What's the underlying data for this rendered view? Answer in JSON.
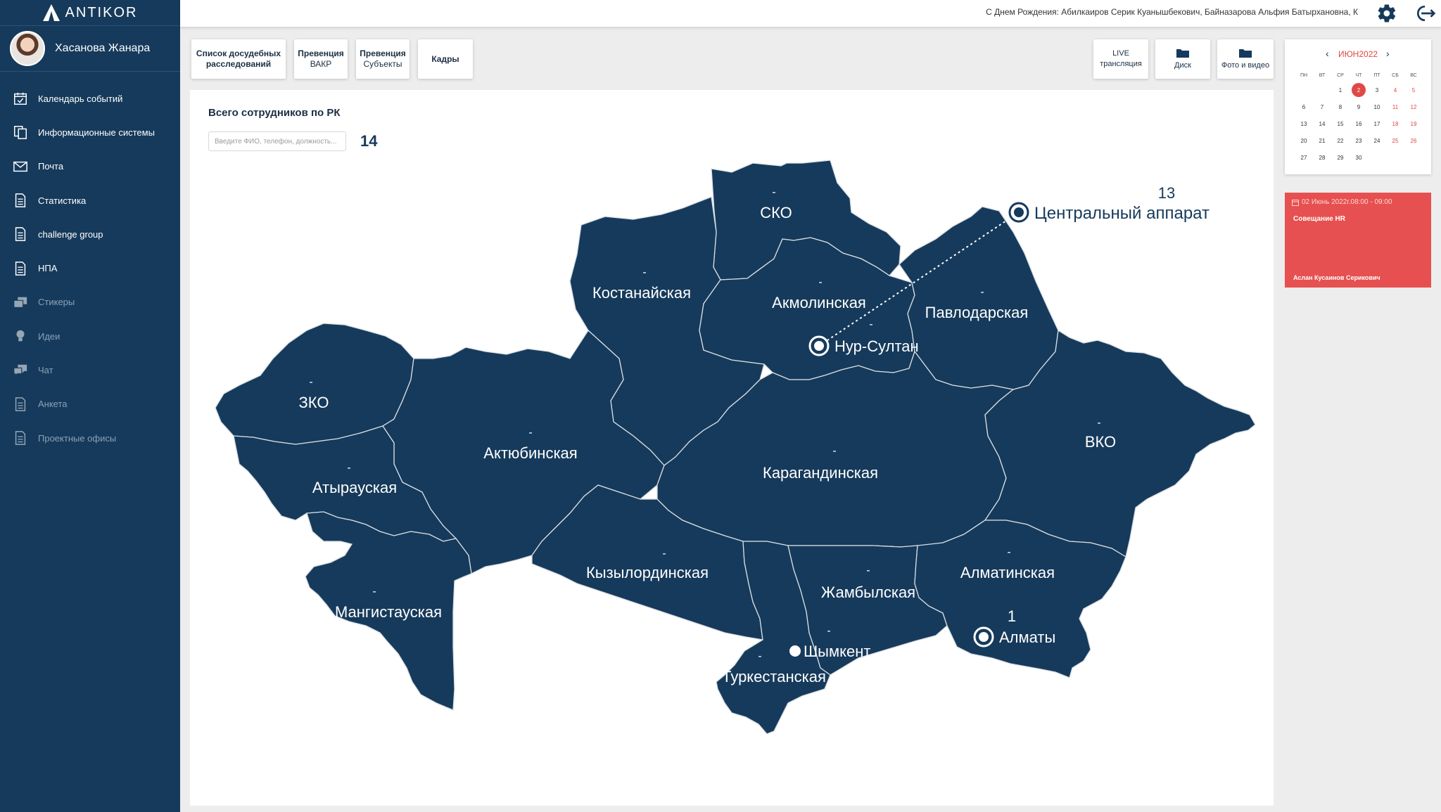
{
  "app": {
    "name": "ANTIKOR"
  },
  "user": {
    "name": "Хасанова Жанара"
  },
  "menu": [
    {
      "label": "Календарь событий",
      "icon": "calendar-icon",
      "dim": false
    },
    {
      "label": "Информационные системы",
      "icon": "documents-icon",
      "dim": false
    },
    {
      "label": "Почта",
      "icon": "mail-icon",
      "dim": false
    },
    {
      "label": "Статистика",
      "icon": "document-icon",
      "dim": false
    },
    {
      "label": "challenge group",
      "icon": "document-icon",
      "dim": false
    },
    {
      "label": "НПА",
      "icon": "document-icon",
      "dim": false
    },
    {
      "label": "Стикеры",
      "icon": "stickers-icon",
      "dim": true
    },
    {
      "label": "Идеи",
      "icon": "lightbulb-icon",
      "dim": true
    },
    {
      "label": "Чат",
      "icon": "chat-icon",
      "dim": true
    },
    {
      "label": "Анкета",
      "icon": "document-icon",
      "dim": true
    },
    {
      "label": "Проектные офисы",
      "icon": "document-icon",
      "dim": true
    }
  ],
  "topbar": {
    "birthday_text": "С Днем Рождения: Абилкаиров Серик Куанышбекович, Байназарова Альфия Батырхановна, К",
    "settings_icon": "gear-icon",
    "logout_icon": "logout-icon"
  },
  "tabs": {
    "t1_line1": "Список досудебных",
    "t1_line2": "расследований",
    "t2_line1": "Превенция",
    "t2_line2": "ВАКР",
    "t3_line1": "Превенция",
    "t3_line2": "Субъекты",
    "t4": "Кадры",
    "live_line1": "LIVE",
    "live_line2": "трансляция",
    "disk": "Диск",
    "photo": "Фото и видео"
  },
  "main": {
    "title": "Всего сотрудников по РК",
    "search_placeholder": "Введите ФИО, телефон, должность...",
    "total": "14"
  },
  "map": {
    "regions": {
      "sko": {
        "name": "СКО",
        "value": "-"
      },
      "kostanay": {
        "name": "Костанайская",
        "value": "-"
      },
      "akmola": {
        "name": "Акмолинская",
        "value": "-"
      },
      "pavlodar": {
        "name": "Павлодарская",
        "value": "-"
      },
      "zko": {
        "name": "ЗКО",
        "value": "-"
      },
      "aktobe": {
        "name": "Актюбинская",
        "value": "-"
      },
      "karaganda": {
        "name": "Карагандинская",
        "value": "-"
      },
      "vko": {
        "name": "ВКО",
        "value": "-"
      },
      "atyrau": {
        "name": "Атырауская",
        "value": "-"
      },
      "kyzylorda": {
        "name": "Кызылординская",
        "value": "-"
      },
      "almaty_reg": {
        "name": "Алматинская",
        "value": "-"
      },
      "zhambyl": {
        "name": "Жамбылская",
        "value": "-"
      },
      "mangystau": {
        "name": "Мангистауская",
        "value": "-"
      },
      "turkestan": {
        "name": "Туркестанская",
        "value": "-"
      }
    },
    "cities": {
      "central": {
        "name": "Центральный аппарат",
        "value": "13"
      },
      "nursultan": {
        "name": "Нур-Султан",
        "value": "-"
      },
      "almaty": {
        "name": "Алматы",
        "value": "1"
      },
      "shymkent": {
        "name": "Шымкент",
        "value": "-"
      }
    }
  },
  "calendar": {
    "month": "ИЮН2022",
    "weekdays": [
      "ПН",
      "ВТ",
      "СР",
      "ЧТ",
      "ПТ",
      "СБ",
      "ВС"
    ],
    "selected_day": "2",
    "weeks": [
      [
        "",
        "",
        "1",
        "2",
        "3",
        "4",
        "5"
      ],
      [
        "6",
        "7",
        "8",
        "9",
        "10",
        "11",
        "12"
      ],
      [
        "13",
        "14",
        "15",
        "16",
        "17",
        "18",
        "19"
      ],
      [
        "20",
        "21",
        "22",
        "23",
        "24",
        "25",
        "26"
      ],
      [
        "27",
        "28",
        "29",
        "30",
        "",
        "",
        ""
      ]
    ]
  },
  "event": {
    "time": "02 Июнь 2022г.08:00 - 09:00",
    "title": "Совещание HR",
    "person": "Аслан Кусаинов Серикович",
    "color": "#e75050"
  },
  "colors": {
    "sidebar": "#163a5b",
    "map_fill": "#163a5b",
    "accent": "#e04848"
  }
}
